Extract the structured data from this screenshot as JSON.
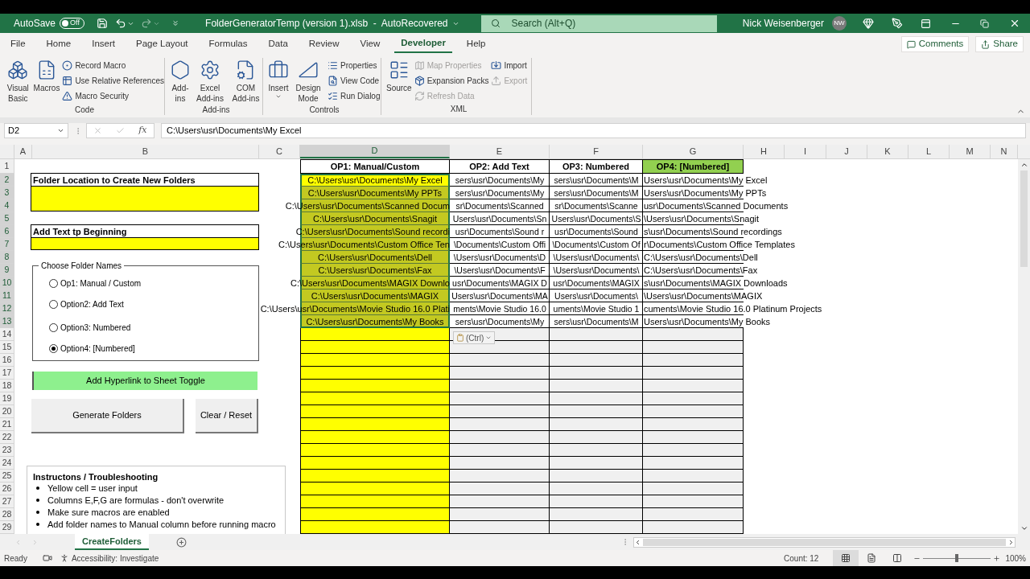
{
  "titlebar": {
    "autosave_label": "AutoSave",
    "autosave": {
      "label": "Off",
      "on": false
    },
    "title": "FolderGeneratorTemp (version 1).xlsb  -  AutoRecovered",
    "search": {
      "placeholder": "Search (Alt+Q)"
    },
    "user": "Nick Weisenberger",
    "avatar": "NW"
  },
  "menu_tabs": [
    {
      "label": "File",
      "selected": false
    },
    {
      "label": "Home",
      "selected": false
    },
    {
      "label": "Insert",
      "selected": false
    },
    {
      "label": "Page Layout",
      "selected": false
    },
    {
      "label": "Formulas",
      "selected": false
    },
    {
      "label": "Data",
      "selected": false
    },
    {
      "label": "Review",
      "selected": false
    },
    {
      "label": "View",
      "selected": false
    },
    {
      "label": "Developer",
      "selected": true
    },
    {
      "label": "Help",
      "selected": false
    }
  ],
  "comments": "Comments",
  "share": "Share",
  "ribbon_groups": [
    {
      "name": "Code",
      "items": [
        {
          "kind": "large",
          "label": "Visual Basic",
          "disabled": false
        },
        {
          "kind": "large",
          "label": "Macros",
          "disabled": false
        },
        {
          "kind": "small",
          "label": "Record Macro",
          "disabled": false
        },
        {
          "kind": "small",
          "label": "Use Relative References",
          "disabled": false
        },
        {
          "kind": "small",
          "label": "Macro Security",
          "disabled": false
        }
      ]
    },
    {
      "name": "Add-ins",
      "items": [
        {
          "kind": "large",
          "label": "Add-ins",
          "disabled": false
        },
        {
          "kind": "large",
          "label": "Excel Add-ins",
          "disabled": false
        },
        {
          "kind": "large",
          "label": "COM Add-ins",
          "disabled": false
        }
      ]
    },
    {
      "name": "Controls",
      "items": [
        {
          "kind": "large",
          "label": "Insert",
          "disabled": false
        },
        {
          "kind": "large",
          "label": "Design Mode",
          "disabled": false
        },
        {
          "kind": "small",
          "label": "Properties",
          "disabled": false
        },
        {
          "kind": "small",
          "label": "View Code",
          "disabled": false
        },
        {
          "kind": "small",
          "label": "Run Dialog",
          "disabled": false
        }
      ]
    },
    {
      "name": "XML",
      "items": [
        {
          "kind": "large",
          "label": "Source",
          "disabled": false
        },
        {
          "kind": "small",
          "label": "Map Properties",
          "disabled": true
        },
        {
          "kind": "small",
          "label": "Expansion Packs",
          "disabled": false
        },
        {
          "kind": "small",
          "label": "Refresh Data",
          "disabled": true
        },
        {
          "kind": "small",
          "label": "Import",
          "disabled": false
        },
        {
          "kind": "small",
          "label": "Export",
          "disabled": true
        }
      ]
    }
  ],
  "formula_bar": {
    "name_box": "D2",
    "function_label": "fx",
    "formula": "C:\\Users\\usr\\Documents\\My Excel"
  },
  "columns": [
    {
      "label": "A",
      "selected": false
    },
    {
      "label": "B",
      "selected": false
    },
    {
      "label": "C",
      "selected": false
    },
    {
      "label": "D",
      "selected": true
    },
    {
      "label": "E",
      "selected": false
    },
    {
      "label": "F",
      "selected": false
    },
    {
      "label": "G",
      "selected": false
    },
    {
      "label": "H",
      "selected": false
    },
    {
      "label": "I",
      "selected": false
    },
    {
      "label": "J",
      "selected": false
    },
    {
      "label": "K",
      "selected": false
    },
    {
      "label": "L",
      "selected": false
    },
    {
      "label": "M",
      "selected": false
    },
    {
      "label": "N",
      "selected": false
    }
  ],
  "row_numbers": [
    {
      "label": "1",
      "selected": false
    },
    {
      "label": "2",
      "selected": true
    },
    {
      "label": "3",
      "selected": true
    },
    {
      "label": "4",
      "selected": true
    },
    {
      "label": "5",
      "selected": true
    },
    {
      "label": "6",
      "selected": true
    },
    {
      "label": "7",
      "selected": true
    },
    {
      "label": "8",
      "selected": true
    },
    {
      "label": "9",
      "selected": true
    },
    {
      "label": "10",
      "selected": true
    },
    {
      "label": "11",
      "selected": true
    },
    {
      "label": "12",
      "selected": true
    },
    {
      "label": "13",
      "selected": true
    },
    {
      "label": "14",
      "selected": false
    },
    {
      "label": "15",
      "selected": false
    },
    {
      "label": "16",
      "selected": false
    },
    {
      "label": "17",
      "selected": false
    },
    {
      "label": "18",
      "selected": false
    },
    {
      "label": "19",
      "selected": false
    },
    {
      "label": "20",
      "selected": false
    },
    {
      "label": "21",
      "selected": false
    },
    {
      "label": "22",
      "selected": false
    },
    {
      "label": "23",
      "selected": false
    },
    {
      "label": "24",
      "selected": false
    },
    {
      "label": "25",
      "selected": false
    },
    {
      "label": "26",
      "selected": false
    },
    {
      "label": "27",
      "selected": false
    },
    {
      "label": "28",
      "selected": false
    },
    {
      "label": "29",
      "selected": false
    }
  ],
  "left_panel": {
    "folder_location_title": "Folder Location to Create New Folders",
    "add_text_title": "Add Text tp Beginning",
    "options_group": {
      "title": "Choose Folder Names",
      "options": [
        {
          "label": "Op1: Manual / Custom",
          "selected": false
        },
        {
          "label": "Option2: Add Text",
          "selected": false
        },
        {
          "label": "Option3: Numbered",
          "selected": false
        },
        {
          "label": "Option4: [Numbered]",
          "selected": true
        }
      ]
    },
    "hyperlink_button": "Add Hyperlink to Sheet Toggle",
    "generate_button": "Generate Folders",
    "clear_button": "Clear / Reset",
    "instructions": {
      "title": "Instructons / Troubleshooting",
      "items": [
        "Yellow cell = user input",
        "Columns E,F,G are formulas - don't overwrite",
        "Make sure macros are enabled",
        "Add folder names to Manual column before running macro"
      ]
    }
  },
  "table": {
    "headers": [
      {
        "label": "OP1: Manual/Custom",
        "highlighted": false
      },
      {
        "label": "OP2: Add Text",
        "highlighted": false
      },
      {
        "label": "OP3: Numbered",
        "highlighted": false
      },
      {
        "label": "OP4: [Numbered]",
        "highlighted": true
      }
    ],
    "rows": [
      {
        "d": "C:\\Users\\usr\\Documents\\My Excel",
        "e": "sers\\usr\\Documents\\My",
        "f": "sers\\usr\\Documents\\M",
        "g": "Users\\usr\\Documents\\My Excel",
        "selected": true,
        "active": true
      },
      {
        "d": "C:\\Users\\usr\\Documents\\My PPTs",
        "e": "sers\\usr\\Documents\\My",
        "f": "sers\\usr\\Documents\\M",
        "g": "Users\\usr\\Documents\\My PPTs",
        "selected": true,
        "active": false
      },
      {
        "d": "C:\\Users\\usr\\Documents\\Scanned Docum",
        "e": "sr\\Documents\\Scanned",
        "f": "sr\\Documents\\Scanne",
        "g": "usr\\Documents\\Scanned Documents",
        "selected": true,
        "active": false
      },
      {
        "d": "C:\\Users\\usr\\Documents\\Snagit",
        "e": "Users\\usr\\Documents\\Sn",
        "f": "Users\\usr\\Documents\\S",
        "g": "\\Users\\usr\\Documents\\Snagit",
        "selected": true,
        "active": false
      },
      {
        "d": "C:\\Users\\usr\\Documents\\Sound recordi",
        "e": "usr\\Documents\\Sound r",
        "f": "usr\\Documents\\Sound",
        "g": "s\\usr\\Documents\\Sound recordings",
        "selected": true,
        "active": false
      },
      {
        "d": "C:\\Users\\usr\\Documents\\Custom Office Ten",
        "e": "\\Documents\\Custom Offi",
        "f": "\\Documents\\Custom Of",
        "g": "r\\Documents\\Custom Office Templates",
        "selected": true,
        "active": false
      },
      {
        "d": "C:\\Users\\usr\\Documents\\Dell",
        "e": "\\Users\\usr\\Documents\\D",
        "f": "\\Users\\usr\\Documents\\",
        "g": "C:\\Users\\usr\\Documents\\Dell",
        "selected": true,
        "active": false
      },
      {
        "d": "C:\\Users\\usr\\Documents\\Fax",
        "e": "\\Users\\usr\\Documents\\F",
        "f": "\\Users\\usr\\Documents\\",
        "g": "C:\\Users\\usr\\Documents\\Fax",
        "selected": true,
        "active": false
      },
      {
        "d": "C:\\Users\\usr\\Documents\\MAGIX Downlo",
        "e": "usr\\Documents\\MAGIX D",
        "f": "usr\\Documents\\MAGIX",
        "g": "s\\usr\\Documents\\MAGIX Downloads",
        "selected": true,
        "active": false
      },
      {
        "d": "C:\\Users\\usr\\Documents\\MAGIX",
        "e": "Users\\usr\\Documents\\MA",
        "f": "Users\\usr\\Documents\\",
        "g": "\\Users\\usr\\Documents\\MAGIX",
        "selected": true,
        "active": false
      },
      {
        "d": "C:\\Users\\usr\\Documents\\Movie Studio 16.0 Plati",
        "e": "ments\\Movie Studio 16.0",
        "f": "uments\\Movie Studio 1",
        "g": "cuments\\Movie Studio 16.0 Platinum Projects",
        "selected": true,
        "active": false
      },
      {
        "d": "C:\\Users\\usr\\Documents\\My Books",
        "e": "sers\\usr\\Documents\\My",
        "f": "sers\\usr\\Documents\\M",
        "g": "Users\\usr\\Documents\\My Books",
        "selected": true,
        "active": false
      }
    ]
  },
  "paste_options": "(Ctrl)",
  "sheet_tabs": [
    {
      "label": "CreateFolders",
      "selected": true
    }
  ],
  "status": {
    "ready": "Ready",
    "accessibility": "Accessibility: Investigate",
    "count": "Count: 12",
    "views": [
      {
        "selected": true
      },
      {
        "selected": false
      },
      {
        "selected": false
      }
    ],
    "zoom": {
      "level": 0.5,
      "label": "100%"
    }
  }
}
